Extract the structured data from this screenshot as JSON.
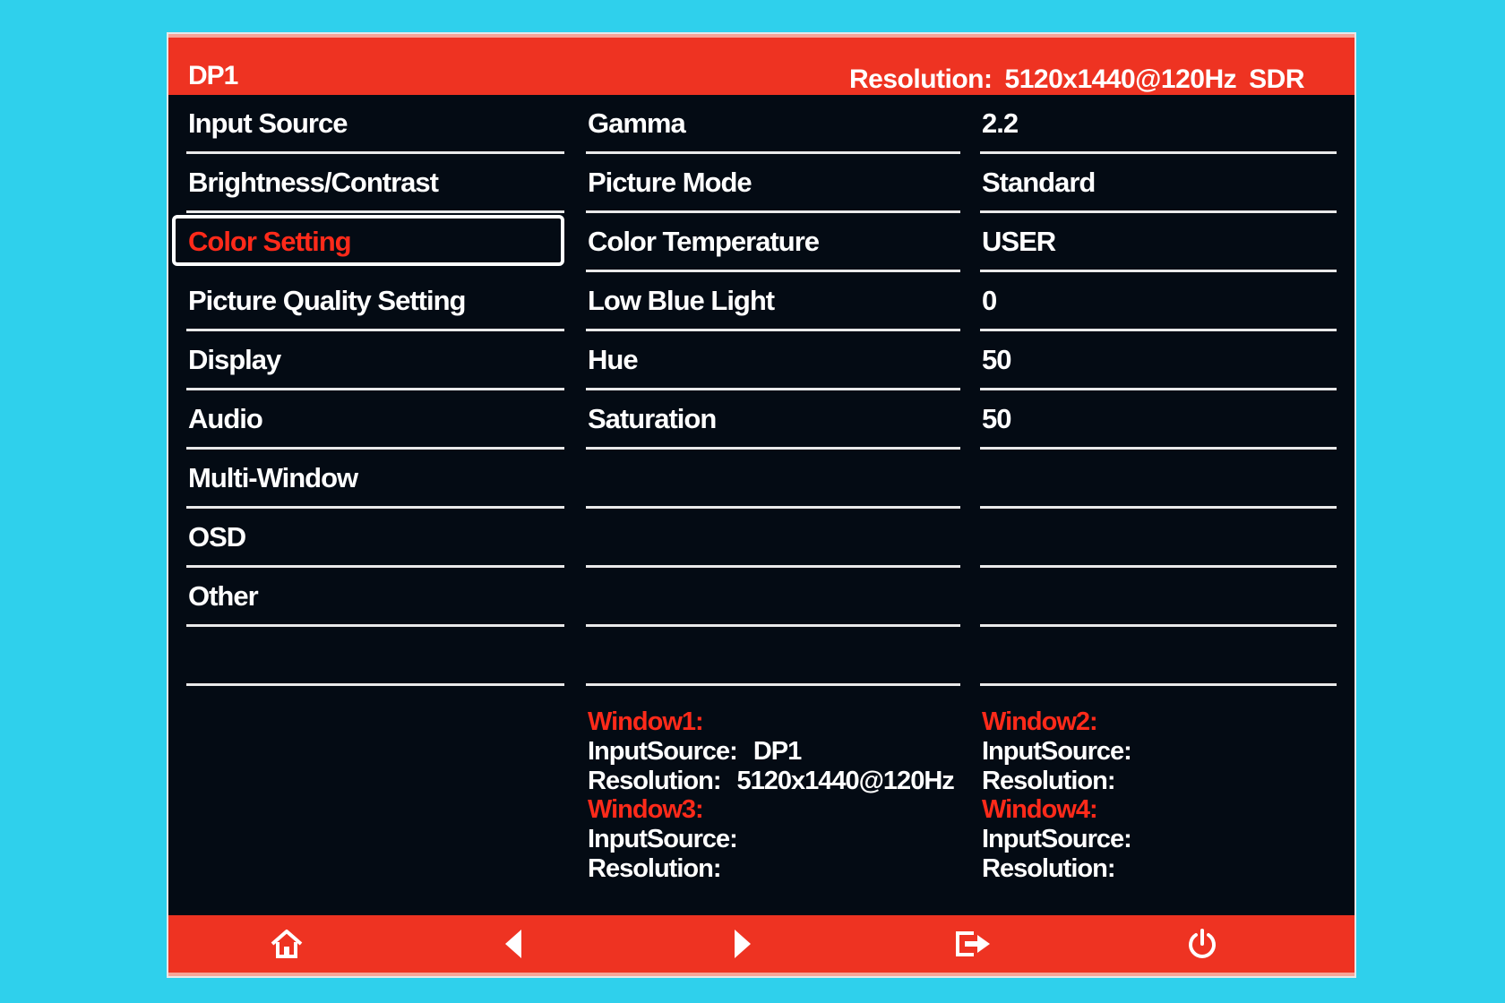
{
  "header": {
    "source": "DP1",
    "resolution_label": "Resolution:",
    "resolution_value": "5120x1440@120Hz",
    "hdr_mode": "SDR"
  },
  "menu": {
    "items": [
      {
        "label": "Input Source"
      },
      {
        "label": "Brightness/Contrast"
      },
      {
        "label": "Color Setting"
      },
      {
        "label": "Picture Quality Setting"
      },
      {
        "label": "Display"
      },
      {
        "label": "Audio"
      },
      {
        "label": "Multi-Window"
      },
      {
        "label": "OSD"
      },
      {
        "label": "Other"
      },
      {
        "label": ""
      }
    ],
    "selected_index": 2
  },
  "params": {
    "items": [
      {
        "label": "Gamma",
        "value": "2.2"
      },
      {
        "label": "Picture Mode",
        "value": "Standard"
      },
      {
        "label": "Color Temperature",
        "value": "USER"
      },
      {
        "label": "Low Blue Light",
        "value": "0"
      },
      {
        "label": "Hue",
        "value": "50"
      },
      {
        "label": "Saturation",
        "value": "50"
      },
      {
        "label": "",
        "value": ""
      },
      {
        "label": "",
        "value": ""
      },
      {
        "label": "",
        "value": ""
      },
      {
        "label": "",
        "value": ""
      }
    ]
  },
  "windows": {
    "w1": {
      "title": "Window1:",
      "input_label": "InputSource:",
      "input_value": "DP1",
      "res_label": "Resolution:",
      "res_value": "5120x1440@120Hz"
    },
    "w2": {
      "title": "Window2:",
      "input_label": "InputSource:",
      "input_value": "",
      "res_label": "Resolution:",
      "res_value": ""
    },
    "w3": {
      "title": "Window3:",
      "input_label": "InputSource:",
      "input_value": "",
      "res_label": "Resolution:",
      "res_value": ""
    },
    "w4": {
      "title": "Window4:",
      "input_label": "InputSource:",
      "input_value": "",
      "res_label": "Resolution:",
      "res_value": ""
    }
  },
  "footer": {
    "buttons": [
      "home-icon",
      "left-arrow-icon",
      "right-arrow-icon",
      "exit-icon",
      "power-icon"
    ]
  },
  "colors": {
    "accent_red": "#ee3322",
    "selected_text": "#ff2a1a",
    "panel_bg": "#040b14",
    "backdrop": "#2fd0ec"
  }
}
